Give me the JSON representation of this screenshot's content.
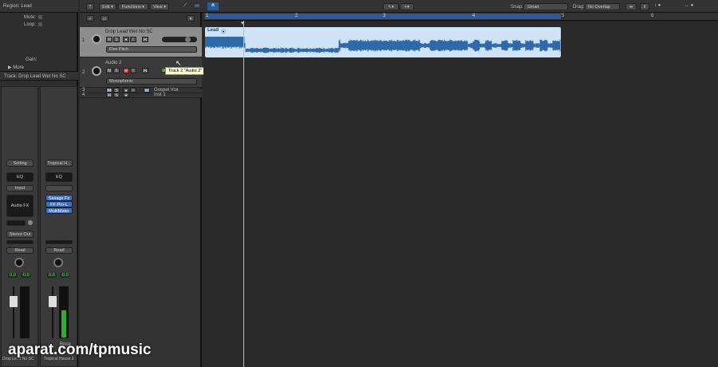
{
  "inspector": {
    "region_title": "Region: Lead",
    "mute_label": "Mute:",
    "loop_label": "Loop:",
    "gain_label": "Gain:",
    "more_label": "More",
    "track_title": "Track:  Drop Lead Wet No SC",
    "strips": [
      {
        "setting": "Setting",
        "eq": "EQ",
        "input": "Input",
        "audio_fx": "Audio FX",
        "output": "Stereo Out",
        "automation": "Read",
        "pan_a": "0.0",
        "pan_b": "-0.0",
        "name": "Drop Le...t No SC",
        "plugins": []
      },
      {
        "setting": "Tropical H...",
        "eq": "EQ",
        "input": "",
        "audio_fx": "",
        "output": "",
        "automation": "Read",
        "pan_a": "0.0",
        "pan_b": "-0.0",
        "name": "Tropical House 2",
        "bnce": "Bnce",
        "plugins": [
          "Savage Fx",
          "FF Pro-L",
          "MultiMeter"
        ]
      }
    ]
  },
  "toolbar": {
    "edit": "Edit",
    "functions": "Functions",
    "view": "View",
    "snap_label": "Snap:",
    "snap_value": "Smart",
    "drag_label": "Drag:",
    "drag_value": "No Overlap"
  },
  "tracks": [
    {
      "num": "1",
      "name": "Drop Lead Wet No SC",
      "mode": "Flex Pitch",
      "m": "M",
      "s": "S",
      "r": "●",
      "i": "I"
    },
    {
      "num": "2",
      "name": "Audio 2",
      "mode": "Monophonic",
      "m": "M",
      "s": "S",
      "r": "●",
      "i": "I"
    },
    {
      "num": "3",
      "name": "Gospel Vox",
      "m": "M",
      "s": "S",
      "r": "●",
      "i": "I"
    },
    {
      "num": "4",
      "name": "Inst 1",
      "m": "M",
      "s": "S",
      "r": "●"
    }
  ],
  "tooltip": "Track 2 \"Audio 2\"",
  "ruler": [
    "1",
    "2",
    "3",
    "4",
    "5",
    "6"
  ],
  "region": {
    "name": "Lead"
  },
  "colors": {
    "region": "#2f6aa8",
    "region_bg": "#cfe3f7",
    "cycle": "#2a5a9a"
  },
  "watermark": "aparat.com/tpmusic"
}
